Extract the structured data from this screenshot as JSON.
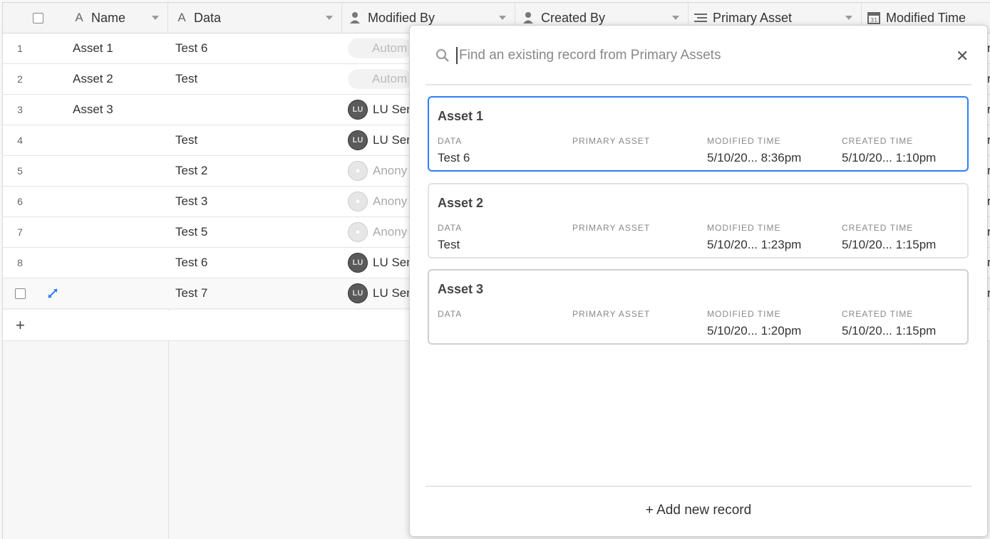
{
  "columns": {
    "name": "Name",
    "data": "Data",
    "modified_by": "Modified By",
    "created_by": "Created By",
    "primary_asset": "Primary Asset",
    "modified_time": "Modified Time"
  },
  "rows": [
    {
      "num": "1",
      "name": "Asset 1",
      "data": "Test 6",
      "user": "Autom",
      "user_kind": "auto"
    },
    {
      "num": "2",
      "name": "Asset 2",
      "data": "Test",
      "user": "Autom",
      "user_kind": "auto"
    },
    {
      "num": "3",
      "name": "Asset 3",
      "data": "",
      "user": "LU Sen",
      "user_kind": "lu"
    },
    {
      "num": "4",
      "name": "",
      "data": "Test",
      "user": "LU Sen",
      "user_kind": "lu"
    },
    {
      "num": "5",
      "name": "",
      "data": "Test 2",
      "user": "Anony",
      "user_kind": "anon"
    },
    {
      "num": "6",
      "name": "",
      "data": "Test 3",
      "user": "Anony",
      "user_kind": "anon"
    },
    {
      "num": "7",
      "name": "",
      "data": "Test 5",
      "user": "Anony",
      "user_kind": "anon"
    },
    {
      "num": "8",
      "name": "",
      "data": "Test 6",
      "user": "LU Sen",
      "user_kind": "lu"
    },
    {
      "num": "",
      "name": "",
      "data": "Test 7",
      "user": "LU Sen",
      "user_kind": "lu"
    }
  ],
  "avatar_initials": "LU",
  "add_row_label": "+",
  "popup": {
    "search_placeholder": "Find an existing record from Primary Assets",
    "close_label": "✕",
    "field_labels": {
      "data": "DATA",
      "primary_asset": "PRIMARY ASSET",
      "modified_time": "MODIFIED TIME",
      "created_time": "CREATED TIME"
    },
    "records": [
      {
        "title": "Asset 1",
        "data": "Test 6",
        "primary_asset": "",
        "modified_time": "5/10/20...  8:36pm",
        "created_time": "5/10/20...  1:10pm"
      },
      {
        "title": "Asset 2",
        "data": "Test",
        "primary_asset": "",
        "modified_time": "5/10/20...  1:23pm",
        "created_time": "5/10/20...  1:15pm"
      },
      {
        "title": "Asset 3",
        "data": "",
        "primary_asset": "",
        "modified_time": "5/10/20...  1:20pm",
        "created_time": "5/10/20...  1:15pm"
      }
    ],
    "add_new_label": "+ Add new record"
  },
  "colors": {
    "accent": "#2d7ff9",
    "expand_icon": "#2d7ff9"
  }
}
